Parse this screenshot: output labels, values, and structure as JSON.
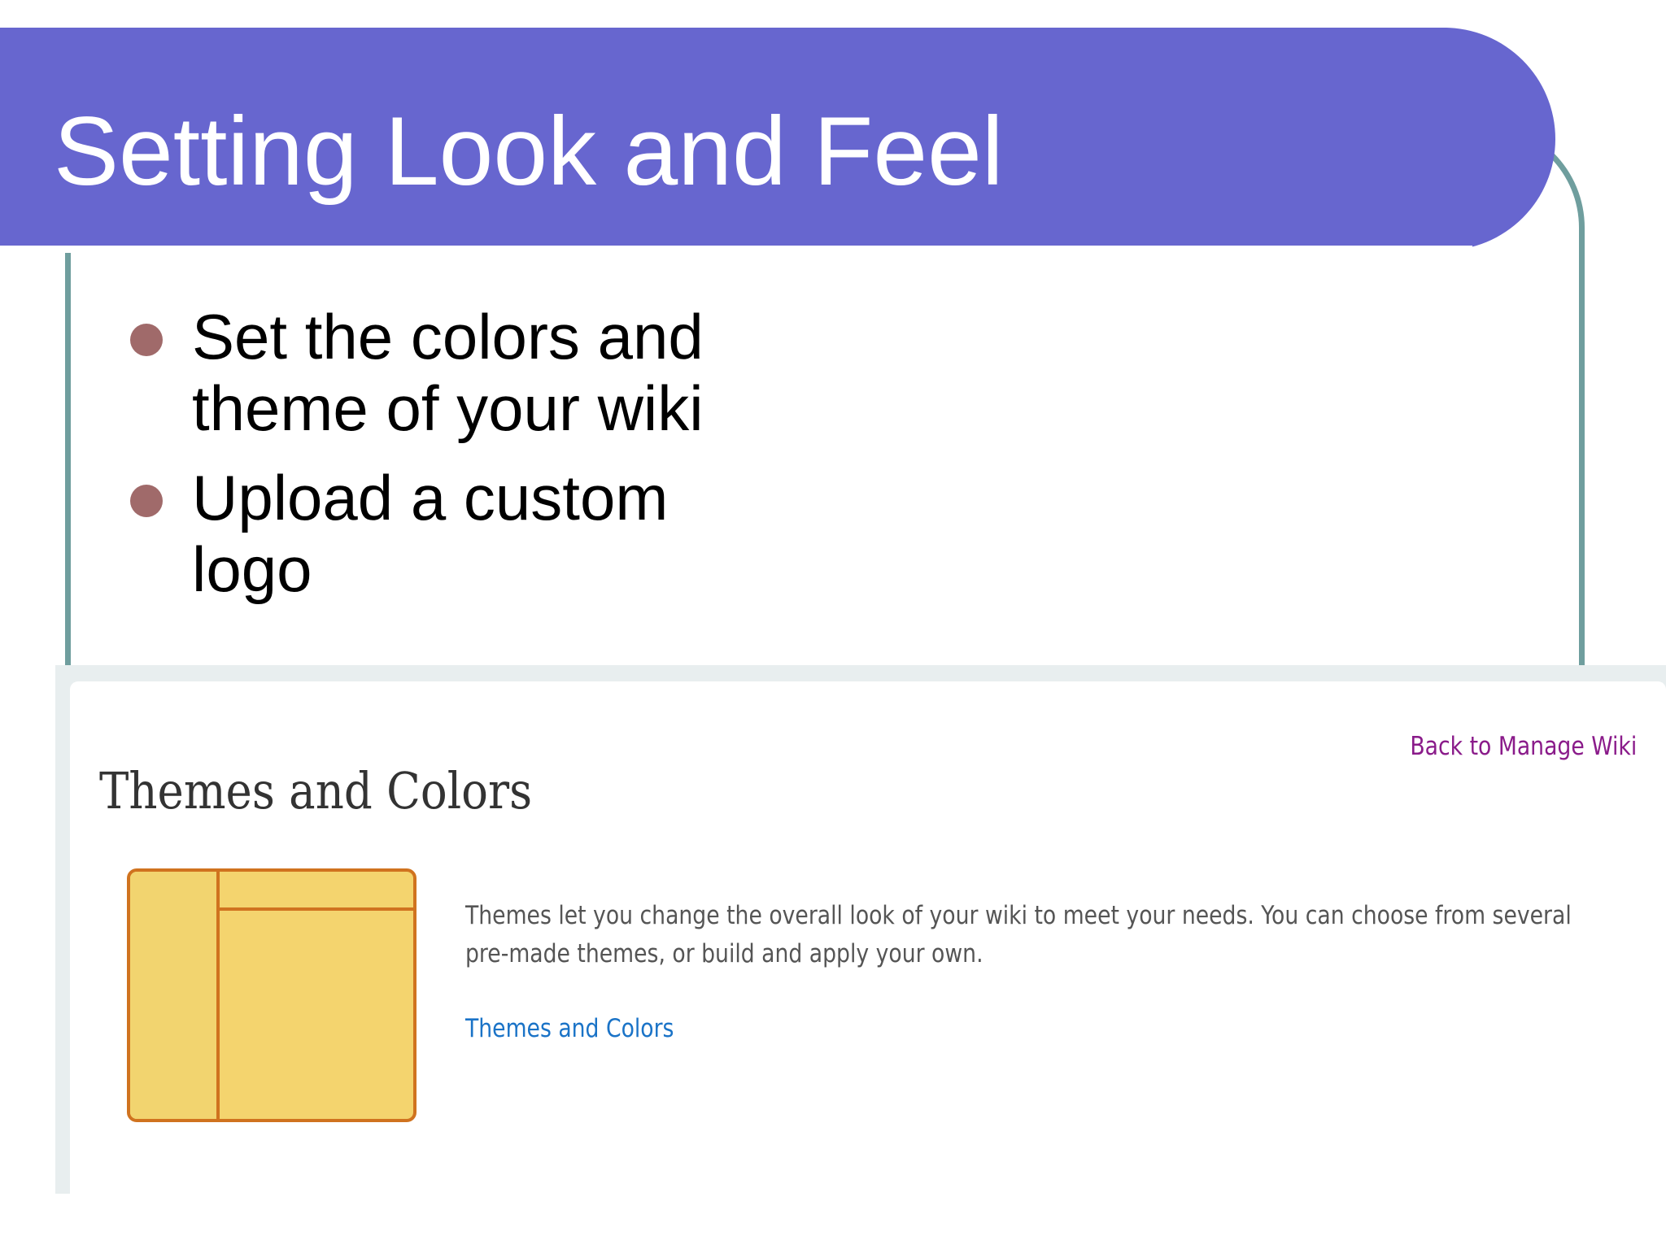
{
  "slide": {
    "title": "Setting Look and Feel",
    "bullets": [
      "Set the colors and theme of your wiki",
      "Upload a custom logo"
    ]
  },
  "screenshot": {
    "back_link": "Back to Manage Wiki",
    "heading": "Themes and Colors",
    "description": "Themes let you change the overall look of your wiki to meet your needs. You can choose from several pre-made themes, or build and apply your own.",
    "link_label": "Themes and Colors",
    "icon": "theme-layout-icon"
  },
  "colors": {
    "title_bar": "#6766cf",
    "frame": "#6f9e9e",
    "bullet": "#a06a6a",
    "link": "#1a73c7",
    "visited_link": "#8a1b8a",
    "icon_fill": "#f4d46e",
    "icon_border": "#d0731f"
  }
}
